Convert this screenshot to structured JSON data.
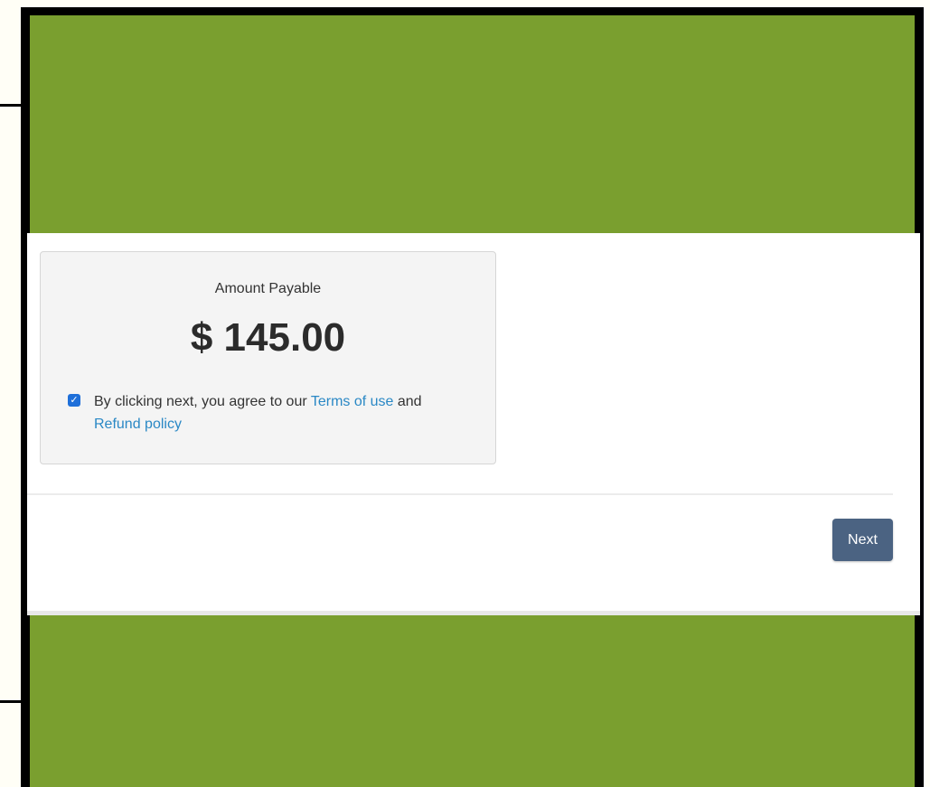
{
  "payment": {
    "amount_label": "Amount Payable",
    "amount_value": "$ 145.00",
    "agree_checked": true,
    "agree_prefix": "By clicking next, you agree to our ",
    "terms_link": "Terms of use",
    "agree_middle": " and ",
    "refund_link": "Refund policy"
  },
  "actions": {
    "next_label": "Next"
  },
  "colors": {
    "background_green": "#7a9f2f",
    "button": "#4b6382",
    "link": "#2a88c5",
    "checkbox": "#1e6fd9"
  }
}
